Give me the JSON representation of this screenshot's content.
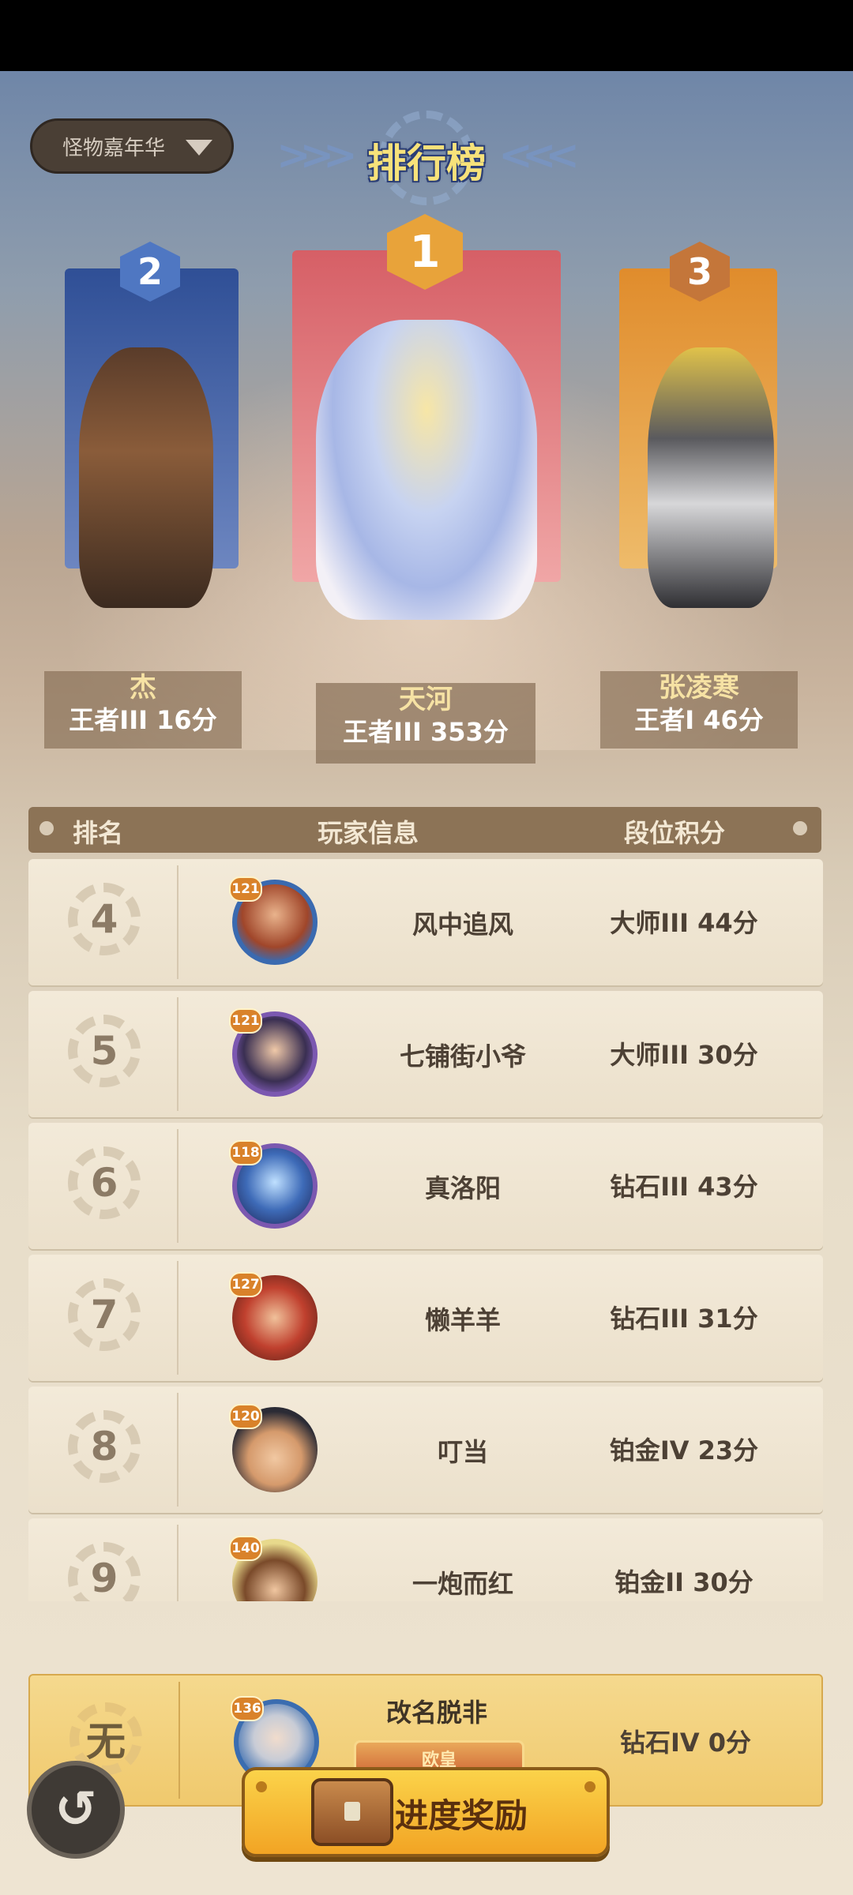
{
  "mode_selector": {
    "label": "怪物嘉年华"
  },
  "title": "排行榜",
  "top3": [
    {
      "rank": "2",
      "name": "杰",
      "score": "王者III  16分",
      "color": "#3c5fa8"
    },
    {
      "rank": "1",
      "name": "天河",
      "score": "王者III  353分",
      "color": "#e47c7e"
    },
    {
      "rank": "3",
      "name": "张凌寒",
      "score": "王者I  46分",
      "color": "#e2963a"
    }
  ],
  "table_headers": {
    "rank": "排名",
    "player": "玩家信息",
    "score": "段位积分"
  },
  "rows": [
    {
      "rank": "4",
      "level": "121",
      "name": "风中追风",
      "score": "大师III  44分"
    },
    {
      "rank": "5",
      "level": "121",
      "name": "七铺街小爷",
      "score": "大师III  30分"
    },
    {
      "rank": "6",
      "level": "118",
      "name": "真洛阳",
      "score": "钻石III  43分"
    },
    {
      "rank": "7",
      "level": "127",
      "name": "懒羊羊",
      "score": "钻石III  31分"
    },
    {
      "rank": "8",
      "level": "120",
      "name": "叮当",
      "score": "铂金IV  23分"
    },
    {
      "rank": "9",
      "level": "140",
      "name": "一炮而红",
      "score": "铂金II  30分"
    }
  ],
  "self": {
    "rank": "无",
    "level": "136",
    "name": "改名脱非",
    "title_badge": "欧皇",
    "score": "钻石IV  0分"
  },
  "progress_button": {
    "label": "进度奖励"
  },
  "back_button": {
    "label": "↺"
  }
}
